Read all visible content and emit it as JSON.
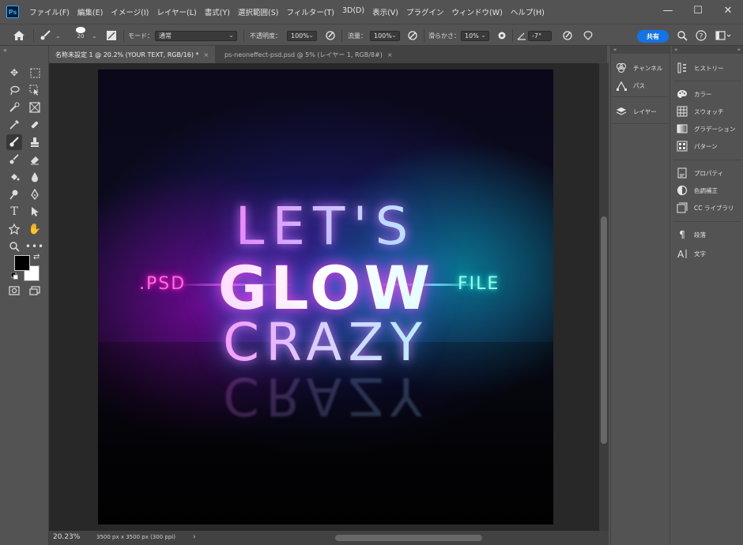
{
  "app": {
    "logo": "Ps"
  },
  "menu": {
    "items": [
      "ファイル(F)",
      "編集(E)",
      "イメージ(I)",
      "レイヤー(L)",
      "書式(Y)",
      "選択範囲(S)",
      "フィルター(T)",
      "3D(D)",
      "表示(V)",
      "プラグイン",
      "ウィンドウ(W)",
      "ヘルプ(H)"
    ]
  },
  "window_controls": {
    "minimize": "—",
    "maximize": "☐",
    "close": "✕"
  },
  "options": {
    "brush_size": "20",
    "mode_label": "モード：",
    "mode_value": "通常",
    "opacity_label": "不透明度：",
    "opacity_value": "100%",
    "flow_label": "流量：",
    "flow_value": "100%",
    "smoothing_label": "滑らかさ：",
    "smoothing_value": "10%",
    "angle_value": "-7°",
    "share_label": "共有"
  },
  "tabs": [
    {
      "label": "名称未設定 1 @ 20.2% (YOUR TEXT, RGB/16) *",
      "close": "×"
    },
    {
      "label": "ps-neoneffect-psd.psd @ 5% (レイヤー 1, RGB/8#)",
      "close": "×"
    }
  ],
  "canvas_text": {
    "line1": "LET'S",
    "line2": "GLOW",
    "line3": "CRAZY",
    "left_tag": ".PSD",
    "right_tag": "FILE"
  },
  "status": {
    "zoom": "20.23%",
    "doc_size": "3500 px x 3500 px (300 ppi)",
    "arrow": "›"
  },
  "mid_panels": [
    {
      "icon": "channels-icon",
      "label": "チャンネル"
    },
    {
      "icon": "paths-icon",
      "label": "パス"
    },
    {
      "icon": "layers-icon",
      "label": "レイヤー"
    }
  ],
  "right_panels": [
    {
      "icon": "history-icon",
      "label": "ヒストリー"
    },
    {
      "icon": "color-icon",
      "label": "カラー"
    },
    {
      "icon": "swatches-icon",
      "label": "スウォッチ"
    },
    {
      "icon": "gradient-icon",
      "label": "グラデーション"
    },
    {
      "icon": "pattern-icon",
      "label": "パターン"
    },
    {
      "icon": "properties-icon",
      "label": "プロパティ"
    },
    {
      "icon": "adjustments-icon",
      "label": "色調補正"
    },
    {
      "icon": "cc-libraries-icon",
      "label": "CC ライブラリ"
    },
    {
      "icon": "paragraph-icon",
      "label": "段落"
    },
    {
      "icon": "character-icon",
      "label": "文字"
    }
  ],
  "colors": {
    "foreground": "#000000",
    "background": "#ffffff",
    "accent": "#1473e6",
    "neon_pink": "#ff2bd0",
    "neon_cyan": "#2dfde0"
  }
}
